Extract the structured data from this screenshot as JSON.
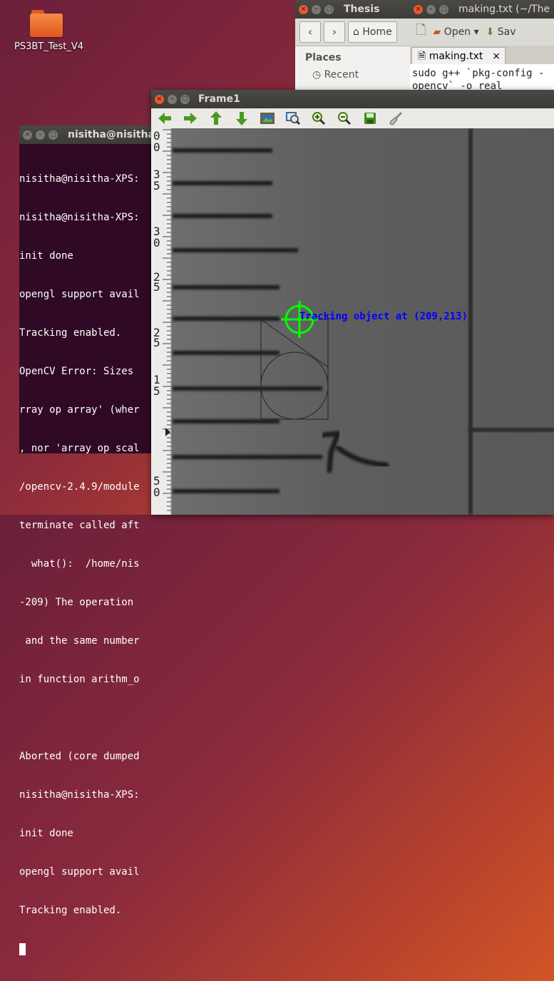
{
  "desktop": {
    "icon_label": "PS3BT_Test_V4"
  },
  "file_manager": {
    "title": "Thesis",
    "home_label": "Home",
    "sidebar_heading": "Places",
    "sidebar_item": "Recent"
  },
  "gedit": {
    "title": "making.txt (~/The",
    "open_label": "Open",
    "save_label": "Sav",
    "tab_label": "making.txt",
    "lines": [
      "sudo g++ `pkg-config -",
      "opencv` -o real"
    ]
  },
  "terminal": {
    "title": "nisitha@nisitha",
    "lines": [
      "nisitha@nisitha-XPS:",
      "nisitha@nisitha-XPS:",
      "init done",
      "opengl support avail",
      "Tracking enabled.",
      "OpenCV Error: Sizes ",
      "rray op array' (wher",
      ", nor 'array op scal",
      "/opencv-2.4.9/module",
      "terminate called aft",
      "  what():  /home/nis",
      "-209) The operation ",
      " and the same number",
      "in function arithm_o",
      "",
      "Aborted (core dumped",
      "nisitha@nisitha-XPS:",
      "init done",
      "opengl support avail",
      "Tracking enabled."
    ]
  },
  "frame": {
    "title": "Frame1",
    "overlay_text": "Tracking object at (209,213)",
    "toolbar_icons": [
      "arrow-left-icon",
      "arrow-right-icon",
      "arrow-up-icon",
      "arrow-down-icon",
      "image-icon",
      "zoom-fit-icon",
      "zoom-in-icon",
      "zoom-out-icon",
      "save-icon",
      "brush-icon"
    ],
    "ruler_labels": [
      "0",
      "0",
      "3",
      "5",
      "3",
      "0",
      "2",
      "5",
      "2",
      "5",
      "1",
      "5",
      "5",
      "0"
    ]
  }
}
